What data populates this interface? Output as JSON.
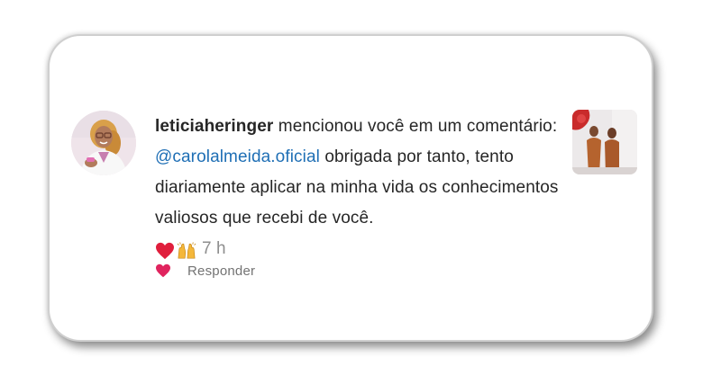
{
  "notification": {
    "username": "leticiaheringer",
    "action_text": " mencionou você em um comentário: ",
    "mention": "@carolalmeida.oficial",
    "comment_text": " obrigada por tanto, tento diariamente aplicar na minha vida os conhecimentos valiosos que recebi de você.",
    "emojis": [
      "red-heart",
      "raising-hands"
    ],
    "time": "7 h",
    "reply_label": "Responder",
    "like_icon": "heart-icon"
  },
  "colors": {
    "text": "#262626",
    "mention": "#1f6fb5",
    "muted": "#8e8e8e",
    "like": "#e0245e",
    "heart_emoji": "#e01e3c"
  }
}
